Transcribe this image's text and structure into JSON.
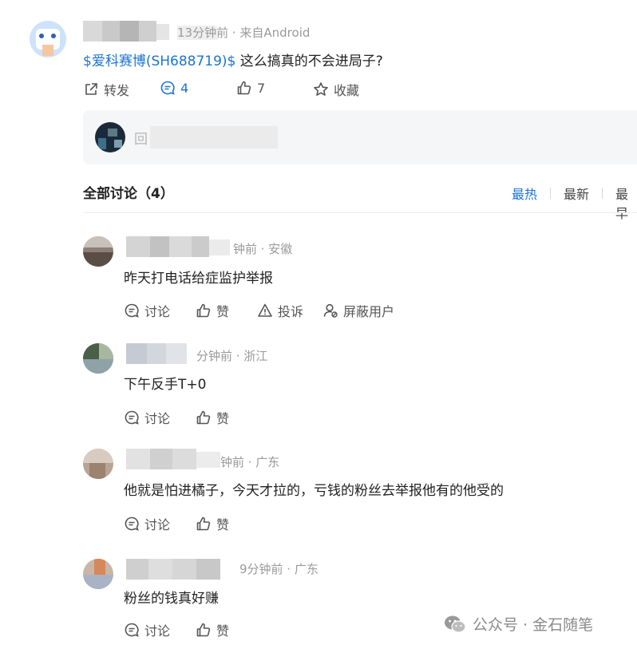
{
  "post": {
    "meta": "13分钟前 · 来自Android",
    "stock_link": "$爱科赛博(SH688719)$",
    "content": " 这么搞真的不会进局子?",
    "actions": {
      "repost_label": "转发",
      "comment_count": "4",
      "like_count": "7",
      "favorite_label": "收藏"
    }
  },
  "reply_box": {
    "placeholder": "回"
  },
  "discussion": {
    "title": "全部讨论（4）",
    "sort_options": [
      "最热",
      "最新",
      "最早"
    ]
  },
  "comments": [
    {
      "meta": "钟前 · 安徽",
      "text": "昨天打电话给症监护举报",
      "actions": [
        "讨论",
        "赞",
        "投诉",
        "屏蔽用户"
      ]
    },
    {
      "meta": "分钟前 · 浙江",
      "text": "下午反手T+0",
      "actions": [
        "讨论",
        "赞"
      ]
    },
    {
      "meta": "钟前 · 广东",
      "text": "他就是怕进橘子，今天才拉的，亏钱的粉丝去举报他有的他受的",
      "actions": [
        "讨论",
        "赞"
      ]
    },
    {
      "meta": "9分钟前 · 广东",
      "text": "粉丝的钱真好赚",
      "actions": [
        "讨论",
        "赞"
      ]
    }
  ],
  "watermark": {
    "text": "公众号 · 金石随笔"
  },
  "colors": {
    "accent": "#1a73d9",
    "meta_gray": "#9a9a9a",
    "reply_box_bg": "#f5f6f7"
  }
}
